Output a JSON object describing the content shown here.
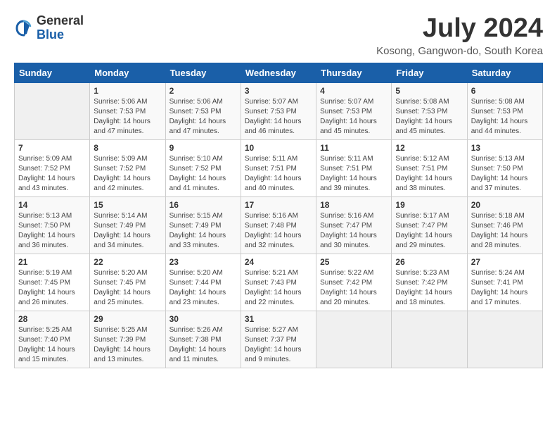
{
  "header": {
    "logo_general": "General",
    "logo_blue": "Blue",
    "month": "July 2024",
    "location": "Kosong, Gangwon-do, South Korea"
  },
  "weekdays": [
    "Sunday",
    "Monday",
    "Tuesday",
    "Wednesday",
    "Thursday",
    "Friday",
    "Saturday"
  ],
  "weeks": [
    [
      {
        "day": "",
        "info": ""
      },
      {
        "day": "1",
        "info": "Sunrise: 5:06 AM\nSunset: 7:53 PM\nDaylight: 14 hours\nand 47 minutes."
      },
      {
        "day": "2",
        "info": "Sunrise: 5:06 AM\nSunset: 7:53 PM\nDaylight: 14 hours\nand 47 minutes."
      },
      {
        "day": "3",
        "info": "Sunrise: 5:07 AM\nSunset: 7:53 PM\nDaylight: 14 hours\nand 46 minutes."
      },
      {
        "day": "4",
        "info": "Sunrise: 5:07 AM\nSunset: 7:53 PM\nDaylight: 14 hours\nand 45 minutes."
      },
      {
        "day": "5",
        "info": "Sunrise: 5:08 AM\nSunset: 7:53 PM\nDaylight: 14 hours\nand 45 minutes."
      },
      {
        "day": "6",
        "info": "Sunrise: 5:08 AM\nSunset: 7:53 PM\nDaylight: 14 hours\nand 44 minutes."
      }
    ],
    [
      {
        "day": "7",
        "info": "Sunrise: 5:09 AM\nSunset: 7:52 PM\nDaylight: 14 hours\nand 43 minutes."
      },
      {
        "day": "8",
        "info": "Sunrise: 5:09 AM\nSunset: 7:52 PM\nDaylight: 14 hours\nand 42 minutes."
      },
      {
        "day": "9",
        "info": "Sunrise: 5:10 AM\nSunset: 7:52 PM\nDaylight: 14 hours\nand 41 minutes."
      },
      {
        "day": "10",
        "info": "Sunrise: 5:11 AM\nSunset: 7:51 PM\nDaylight: 14 hours\nand 40 minutes."
      },
      {
        "day": "11",
        "info": "Sunrise: 5:11 AM\nSunset: 7:51 PM\nDaylight: 14 hours\nand 39 minutes."
      },
      {
        "day": "12",
        "info": "Sunrise: 5:12 AM\nSunset: 7:51 PM\nDaylight: 14 hours\nand 38 minutes."
      },
      {
        "day": "13",
        "info": "Sunrise: 5:13 AM\nSunset: 7:50 PM\nDaylight: 14 hours\nand 37 minutes."
      }
    ],
    [
      {
        "day": "14",
        "info": "Sunrise: 5:13 AM\nSunset: 7:50 PM\nDaylight: 14 hours\nand 36 minutes."
      },
      {
        "day": "15",
        "info": "Sunrise: 5:14 AM\nSunset: 7:49 PM\nDaylight: 14 hours\nand 34 minutes."
      },
      {
        "day": "16",
        "info": "Sunrise: 5:15 AM\nSunset: 7:49 PM\nDaylight: 14 hours\nand 33 minutes."
      },
      {
        "day": "17",
        "info": "Sunrise: 5:16 AM\nSunset: 7:48 PM\nDaylight: 14 hours\nand 32 minutes."
      },
      {
        "day": "18",
        "info": "Sunrise: 5:16 AM\nSunset: 7:47 PM\nDaylight: 14 hours\nand 30 minutes."
      },
      {
        "day": "19",
        "info": "Sunrise: 5:17 AM\nSunset: 7:47 PM\nDaylight: 14 hours\nand 29 minutes."
      },
      {
        "day": "20",
        "info": "Sunrise: 5:18 AM\nSunset: 7:46 PM\nDaylight: 14 hours\nand 28 minutes."
      }
    ],
    [
      {
        "day": "21",
        "info": "Sunrise: 5:19 AM\nSunset: 7:45 PM\nDaylight: 14 hours\nand 26 minutes."
      },
      {
        "day": "22",
        "info": "Sunrise: 5:20 AM\nSunset: 7:45 PM\nDaylight: 14 hours\nand 25 minutes."
      },
      {
        "day": "23",
        "info": "Sunrise: 5:20 AM\nSunset: 7:44 PM\nDaylight: 14 hours\nand 23 minutes."
      },
      {
        "day": "24",
        "info": "Sunrise: 5:21 AM\nSunset: 7:43 PM\nDaylight: 14 hours\nand 22 minutes."
      },
      {
        "day": "25",
        "info": "Sunrise: 5:22 AM\nSunset: 7:42 PM\nDaylight: 14 hours\nand 20 minutes."
      },
      {
        "day": "26",
        "info": "Sunrise: 5:23 AM\nSunset: 7:42 PM\nDaylight: 14 hours\nand 18 minutes."
      },
      {
        "day": "27",
        "info": "Sunrise: 5:24 AM\nSunset: 7:41 PM\nDaylight: 14 hours\nand 17 minutes."
      }
    ],
    [
      {
        "day": "28",
        "info": "Sunrise: 5:25 AM\nSunset: 7:40 PM\nDaylight: 14 hours\nand 15 minutes."
      },
      {
        "day": "29",
        "info": "Sunrise: 5:25 AM\nSunset: 7:39 PM\nDaylight: 14 hours\nand 13 minutes."
      },
      {
        "day": "30",
        "info": "Sunrise: 5:26 AM\nSunset: 7:38 PM\nDaylight: 14 hours\nand 11 minutes."
      },
      {
        "day": "31",
        "info": "Sunrise: 5:27 AM\nSunset: 7:37 PM\nDaylight: 14 hours\nand 9 minutes."
      },
      {
        "day": "",
        "info": ""
      },
      {
        "day": "",
        "info": ""
      },
      {
        "day": "",
        "info": ""
      }
    ]
  ]
}
